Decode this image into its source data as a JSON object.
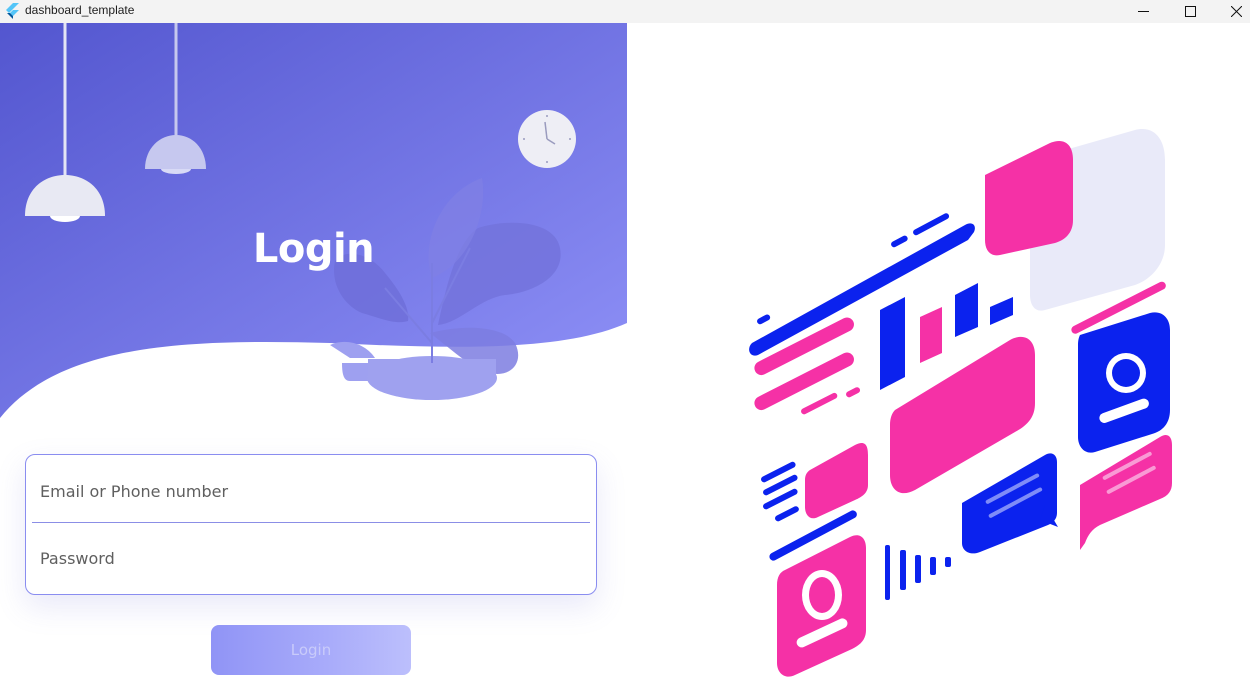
{
  "window": {
    "title": "dashboard_template"
  },
  "login": {
    "heading": "Login",
    "email_placeholder": "Email or Phone number",
    "password_placeholder": "Password",
    "button_label": "Login"
  },
  "colors": {
    "brand": "#7174e6",
    "accent_pink": "#f531a6",
    "accent_blue": "#0b22ee"
  },
  "icons": {
    "app": "flutter-logo-icon",
    "minimize": "minimize-icon",
    "maximize": "maximize-icon",
    "close": "close-icon"
  }
}
